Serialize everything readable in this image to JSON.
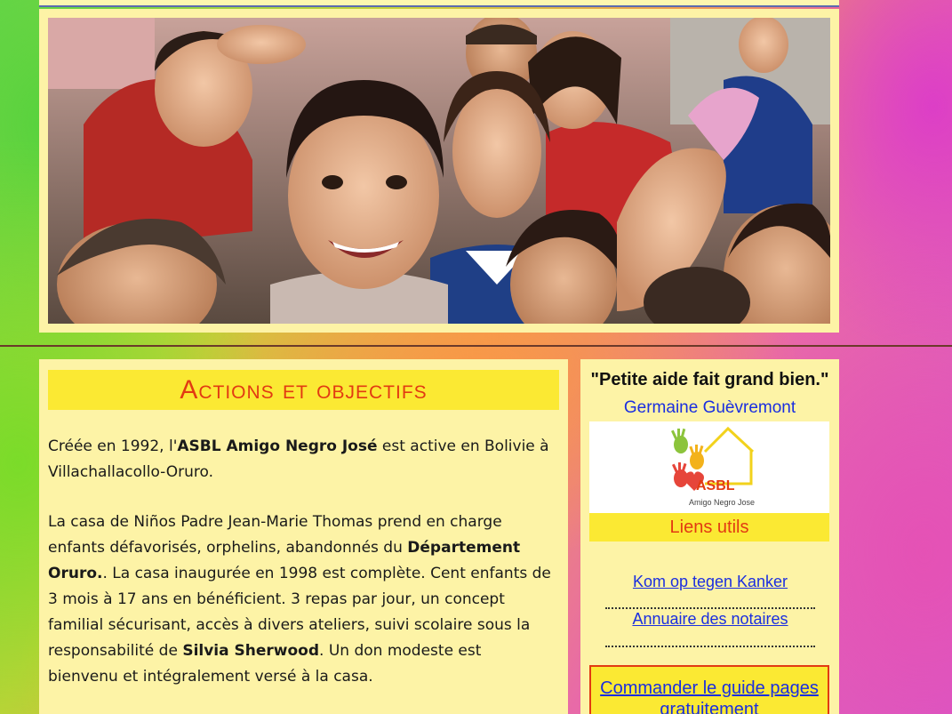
{
  "hero": {
    "image_description": "group of smiling children"
  },
  "main": {
    "title": "Actions et objectifs",
    "paragraph1": {
      "p1": "Créée en 1992, l'",
      "b1": "ASBL Amigo Negro José",
      "p2": " est active en Bolivie à Villachallacollo-Oruro."
    },
    "paragraph2": {
      "p1": "La casa de Niños Padre Jean-Marie Thomas prend en charge enfants défavorisés, orphelins, abandonnés du ",
      "b1": "Département Oruro.",
      "p2": ". La casa inaugurée en 1998 est complète. Cent enfants de 3 mois à 17 ans en bénéficient. 3 repas par jour, un concept familial sécurisant, accès à divers ateliers, suivi scolaire sous la responsabilité de ",
      "b2": "Silvia Sherwood",
      "p3": ". Un don modeste est bienvenu et intégralement versé à la casa."
    }
  },
  "sidebar": {
    "quote": "\"Petite aide fait grand bien.\"",
    "quote_author": "Germaine Guèvremont",
    "logo": {
      "text": "ASBL",
      "subtext": "Amigo Negro Jose"
    },
    "links_title": "Liens utils",
    "links": [
      {
        "label": "Kom op tegen Kanker"
      },
      {
        "label": "Annuaire des notaires"
      }
    ],
    "guide_link": "Commander le guide pages gratuitement"
  },
  "colors": {
    "panel_bg": "#fdf3a6",
    "title_bar": "#fbe933",
    "title_text": "#e23a12",
    "link": "#1a2ee0"
  }
}
